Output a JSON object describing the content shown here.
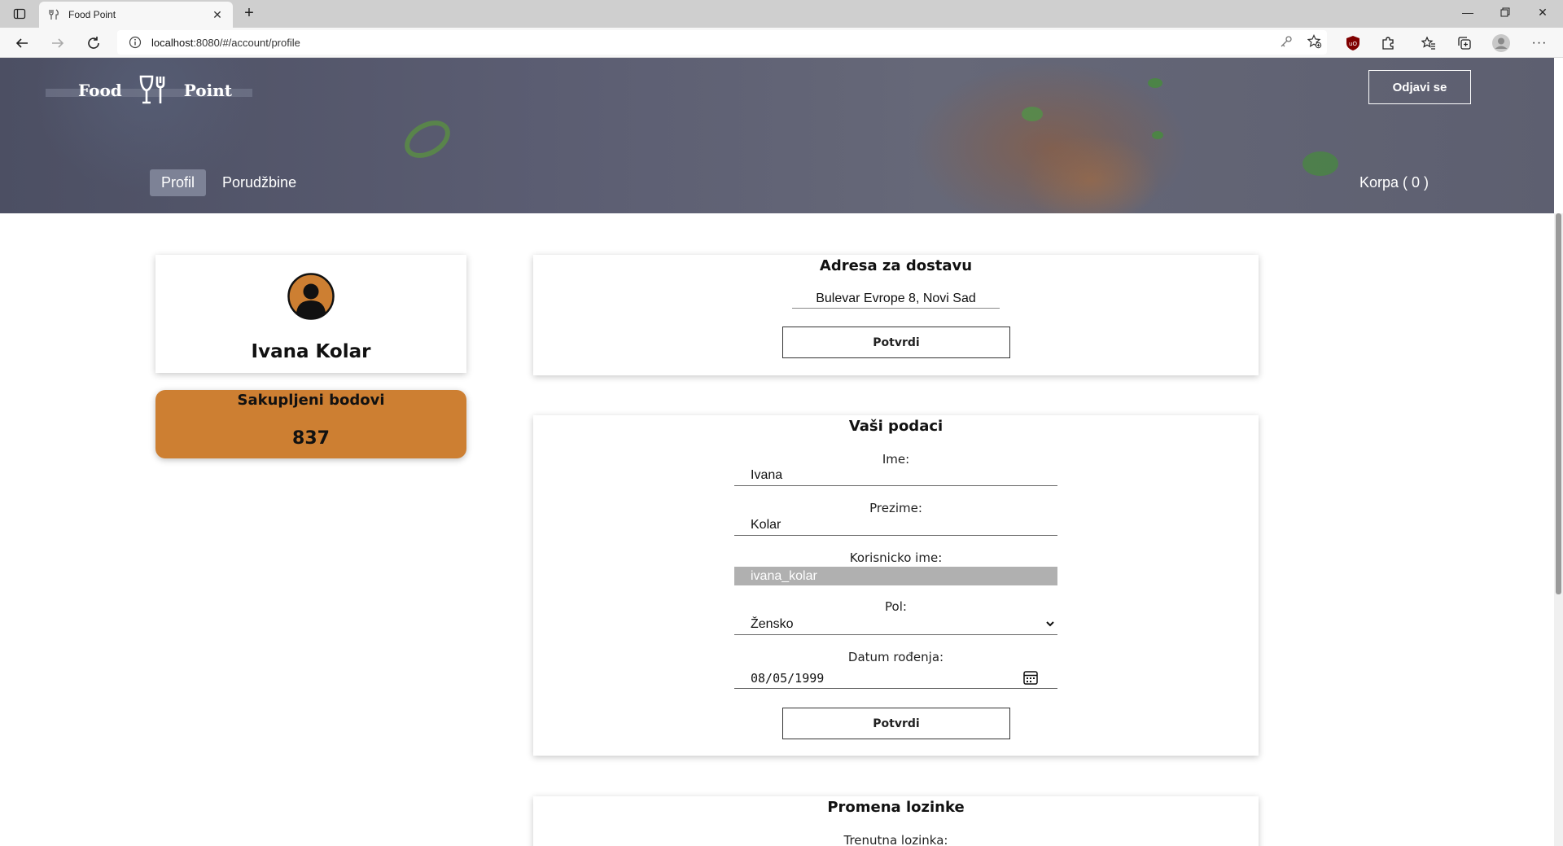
{
  "browser": {
    "tab_title": "Food Point",
    "url_host": "localhost",
    "url_rest": ":8080/#/account/profile",
    "icons": [
      "tab-actions-icon",
      "back-icon",
      "forward-icon",
      "reload-icon",
      "site-info-icon",
      "key-icon",
      "favorite-add-icon",
      "ublock-icon",
      "extensions-icon",
      "favorites-icon",
      "collections-icon",
      "profile-icon",
      "more-icon"
    ]
  },
  "header": {
    "logo_left": "Food",
    "logo_right": "Point",
    "logout_label": "Odjavi se",
    "nav": [
      "Profil",
      "Porudžbine"
    ],
    "cart_label": "Korpa ( 0 )"
  },
  "profile": {
    "name": "Ivana Kolar",
    "avatar_color": "#cd7f32",
    "points_title": "Sakupljeni bodovi",
    "points_value": "837"
  },
  "address": {
    "title": "Adresa za dostavu",
    "value": "Bulevar Evrope 8, Novi Sad",
    "confirm_label": "Potvrdi"
  },
  "user_form": {
    "title": "Vaši podaci",
    "first_name_label": "Ime:",
    "first_name_value": "Ivana",
    "last_name_label": "Prezime:",
    "last_name_value": "Kolar",
    "username_label": "Korisnicko ime:",
    "username_value": "ivana_kolar",
    "gender_label": "Pol:",
    "gender_value": "Žensko",
    "birth_label": "Datum rođenja:",
    "birth_value": "08/05/1999",
    "confirm_label": "Potvrdi"
  },
  "password_form": {
    "title": "Promena lozinke",
    "current_label": "Trenutna lozinka:"
  }
}
